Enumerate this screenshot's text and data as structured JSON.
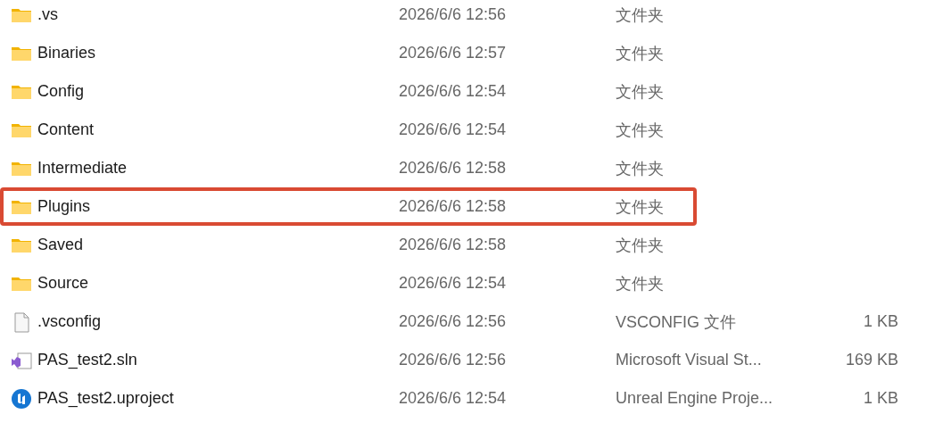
{
  "files": [
    {
      "kind": "folder",
      "name": ".vs",
      "modified": "2026/6/6 12:56",
      "type": "文件夹",
      "highlighted": false
    },
    {
      "kind": "folder",
      "name": "Binaries",
      "modified": "2026/6/6 12:57",
      "type": "文件夹",
      "highlighted": false
    },
    {
      "kind": "folder",
      "name": "Config",
      "modified": "2026/6/6 12:54",
      "type": "文件夹",
      "highlighted": false
    },
    {
      "kind": "folder",
      "name": "Content",
      "modified": "2026/6/6 12:54",
      "type": "文件夹",
      "highlighted": false
    },
    {
      "kind": "folder",
      "name": "Intermediate",
      "modified": "2026/6/6 12:58",
      "type": "文件夹",
      "highlighted": false
    },
    {
      "kind": "folder",
      "name": "Plugins",
      "modified": "2026/6/6 12:58",
      "type": "文件夹",
      "highlighted": true
    },
    {
      "kind": "folder",
      "name": "Saved",
      "modified": "2026/6/6 12:58",
      "type": "文件夹",
      "highlighted": false
    },
    {
      "kind": "folder",
      "name": "Source",
      "modified": "2026/6/6 12:54",
      "type": "文件夹",
      "highlighted": false
    },
    {
      "kind": "file",
      "name": ".vsconfig",
      "modified": "2026/6/6 12:56",
      "type": "VSCONFIG 文件",
      "size": "1 KB",
      "highlighted": false
    },
    {
      "kind": "solution",
      "name": "PAS_test2.sln",
      "modified": "2026/6/6 12:56",
      "type": "Microsoft Visual St...",
      "size": "169 KB",
      "highlighted": false
    },
    {
      "kind": "project",
      "name": "PAS_test2.uproject",
      "modified": "2026/6/6 12:54",
      "type": "Unreal Engine Proje...",
      "size": "1 KB",
      "highlighted": false
    }
  ]
}
